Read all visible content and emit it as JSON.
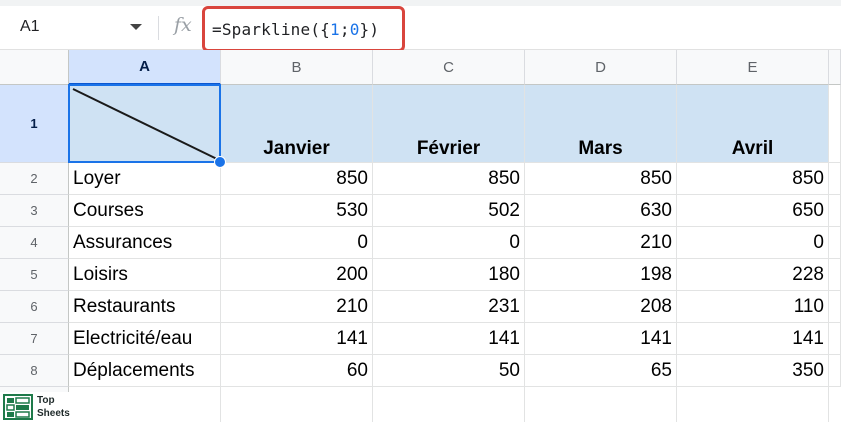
{
  "name_box": {
    "value": "A1"
  },
  "formula_bar": {
    "fx_label": "fx",
    "parts": [
      {
        "t": "=Sparkline({",
        "k": "p"
      },
      {
        "t": "1",
        "k": "n"
      },
      {
        "t": ";",
        "k": "p"
      },
      {
        "t": "0",
        "k": "n"
      },
      {
        "t": "})",
        "k": "p"
      }
    ]
  },
  "columns": [
    "A",
    "B",
    "C",
    "D",
    "E"
  ],
  "rows": [
    [
      "1",
      "",
      "Janvier",
      "Février",
      "Mars",
      "Avril"
    ],
    [
      "2",
      "Loyer",
      "850",
      "850",
      "850",
      "850"
    ],
    [
      "3",
      "Courses",
      "530",
      "502",
      "630",
      "650"
    ],
    [
      "4",
      "Assurances",
      "0",
      "0",
      "210",
      "0"
    ],
    [
      "5",
      "Loisirs",
      "200",
      "180",
      "198",
      "228"
    ],
    [
      "6",
      "Restaurants",
      "210",
      "231",
      "208",
      "110"
    ],
    [
      "7",
      "Electricité/eau",
      "141",
      "141",
      "141",
      "141"
    ],
    [
      "8",
      "Déplacements",
      "60",
      "50",
      "65",
      "350"
    ]
  ],
  "colors": {
    "header_fill": "#cfe2f3",
    "selection": "#1a73e8",
    "formula_highlight": "#d9453d",
    "number_token": "#1a73e8"
  },
  "logo": {
    "line1": "Top",
    "line2": "Sheets"
  }
}
